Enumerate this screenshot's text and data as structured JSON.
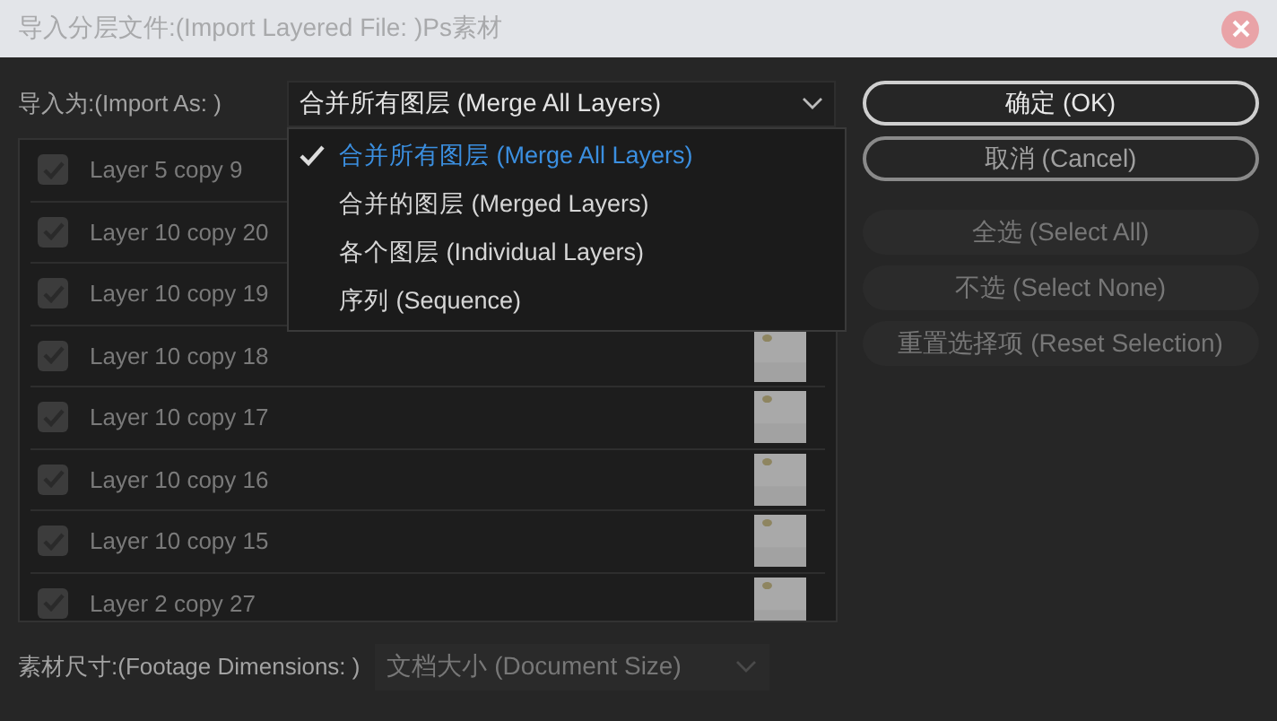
{
  "window": {
    "title": "导入分层文件:(Import Layered File: )Ps素材"
  },
  "import_as": {
    "label": "导入为:(Import As: )",
    "value": "合并所有图层 (Merge All Layers)",
    "expanded": true,
    "options": [
      {
        "label": "合并所有图层 (Merge All Layers)",
        "selected": true
      },
      {
        "label": "合并的图层 (Merged Layers)",
        "selected": false
      },
      {
        "label": "各个图层 (Individual Layers)",
        "selected": false
      },
      {
        "label": "序列 (Sequence)",
        "selected": false
      }
    ]
  },
  "layers": {
    "disabled": true,
    "items": [
      {
        "name": "Layer 5 copy 9",
        "checked": true
      },
      {
        "name": "Layer 10 copy 20",
        "checked": true
      },
      {
        "name": "Layer 10 copy 19",
        "checked": true
      },
      {
        "name": "Layer 10 copy 18",
        "checked": true,
        "thumbnail": true
      },
      {
        "name": "Layer 10 copy 17",
        "checked": true,
        "thumbnail": true
      },
      {
        "name": "Layer 10 copy 16",
        "checked": true,
        "thumbnail": true
      },
      {
        "name": "Layer 10 copy 15",
        "checked": true,
        "thumbnail": true
      },
      {
        "name": "Layer 2 copy 27",
        "checked": true,
        "thumbnail": true
      }
    ]
  },
  "buttons": [
    {
      "label": "确定 (OK)",
      "disabled": false,
      "default": true
    },
    {
      "label": "取消 (Cancel)",
      "disabled": false,
      "default": false
    },
    {
      "label": "全选 (Select All)",
      "disabled": true,
      "default": false
    },
    {
      "label": "不选 (Select None)",
      "disabled": true,
      "default": false
    },
    {
      "label": "重置选择项 (Reset Selection)",
      "disabled": true,
      "default": false
    }
  ],
  "footage": {
    "label": "素材尺寸:(Footage Dimensions: )",
    "value": "文档大小 (Document Size)",
    "disabled": true
  }
}
